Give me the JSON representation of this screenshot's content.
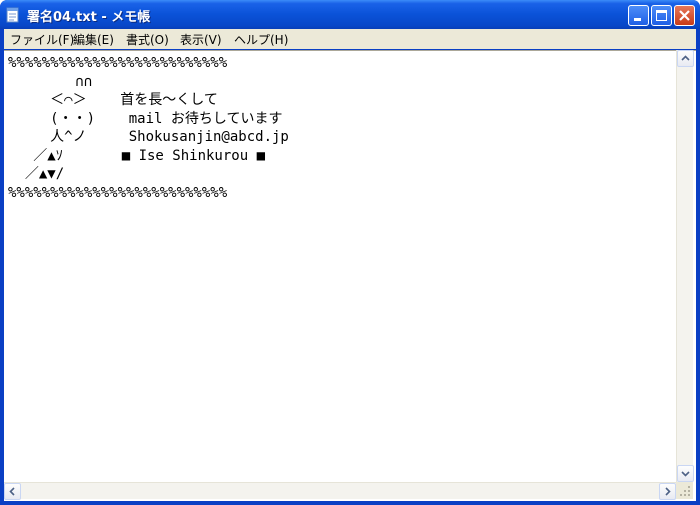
{
  "window": {
    "title": "署名04.txt - メモ帳"
  },
  "menu": [
    "ファイル(F)",
    "編集(E)",
    "書式(O)",
    "表示(V)",
    "ヘルプ(H)"
  ],
  "document": {
    "lines": [
      "%%%%%%%%%%%%%%%%%%%%%%%%%%",
      "        ∩∩",
      "     ＜⌒＞    首を長～くして",
      "     (・・)    mail お待ちしています",
      "     人^ノ     Shokusanjin@abcd.jp",
      "   ／▲ｿ       ■ Ise Shinkurou ■",
      "  ／▲▼/",
      "%%%%%%%%%%%%%%%%%%%%%%%%%%"
    ]
  },
  "icons": {
    "app": "notepad-icon",
    "minimize": "minimize-icon",
    "maximize": "maximize-icon",
    "close": "close-icon"
  },
  "colors": {
    "titlebar": "#0a52d8",
    "menubar": "#ece9d8",
    "close_button": "#c73a17"
  }
}
